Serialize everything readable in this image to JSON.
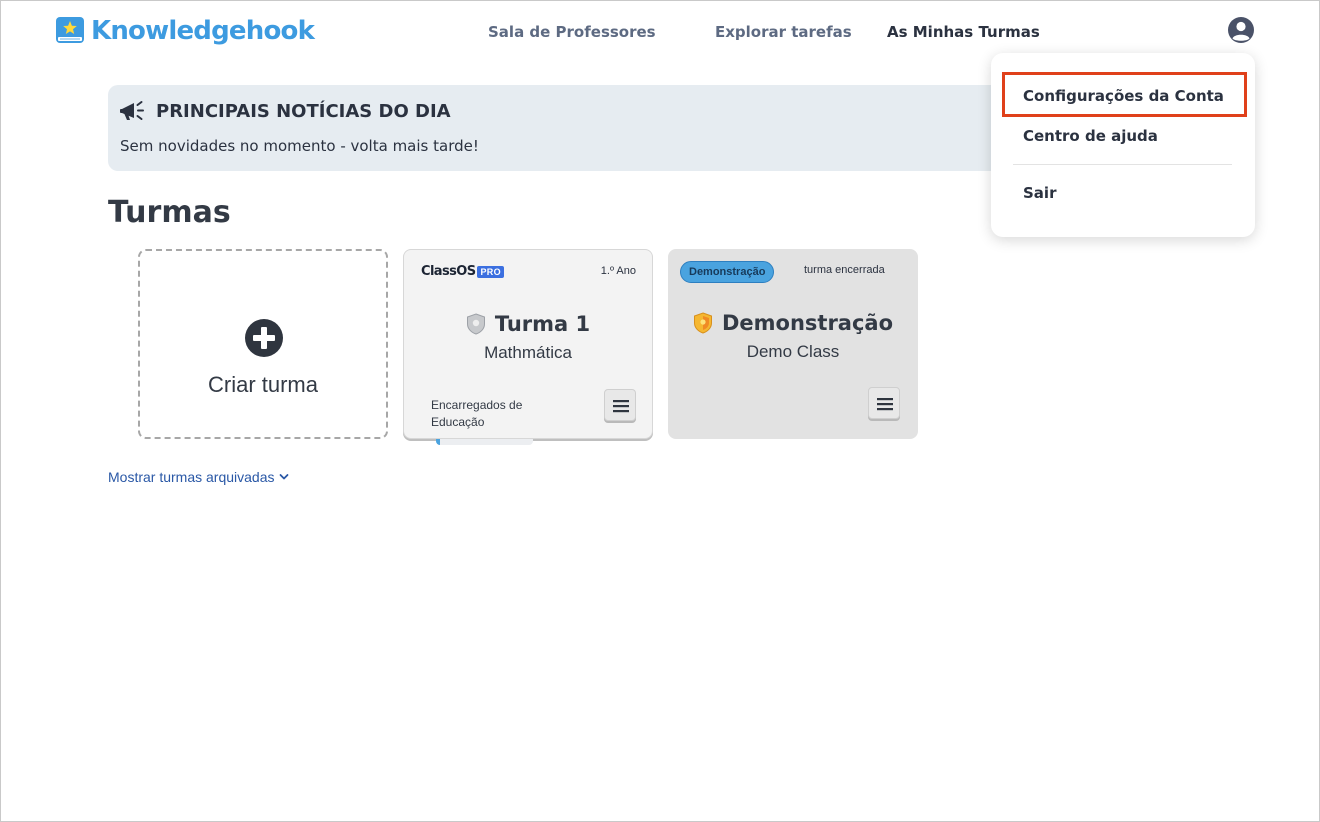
{
  "header": {
    "brand": "Knowledgehook",
    "nav": [
      {
        "label": "Sala de Professores"
      },
      {
        "label": "Explorar tarefas"
      },
      {
        "label": "As Minhas Turmas"
      }
    ]
  },
  "account_menu": {
    "items": [
      {
        "label": "Configurações da Conta"
      },
      {
        "label": "Centro de ajuda"
      },
      {
        "label": "Sair"
      }
    ]
  },
  "news": {
    "title": "PRINCIPAIS NOTÍCIAS DO DIA",
    "text": "Sem novidades no momento - volta mais tarde!"
  },
  "classes": {
    "title": "Turmas",
    "create_label": "Criar turma",
    "cards": [
      {
        "brand": "ClassOS",
        "brand_badge": "PRO",
        "grade": "1.º Ano",
        "name": "Turma 1",
        "subject": "Mathmática",
        "guardians_label": "Encarregados de Educação",
        "progress": 0.04
      },
      {
        "badge": "Demonstração",
        "status": "turma encerrada",
        "name": "Demonstração",
        "subject": "Demo Class"
      }
    ],
    "archived_link": "Mostrar turmas arquivadas"
  },
  "colors": {
    "brand": "#3d9be0",
    "highlight": "#e0401a",
    "news_bg": "#e6ecf1",
    "link": "#2a58a6"
  },
  "icons": [
    "book-star-logo-icon",
    "user-account-icon",
    "megaphone-icon",
    "plus-circle-icon",
    "shield-silver-icon",
    "shield-gold-icon",
    "hamburger-menu-icon",
    "chevron-down-icon"
  ]
}
